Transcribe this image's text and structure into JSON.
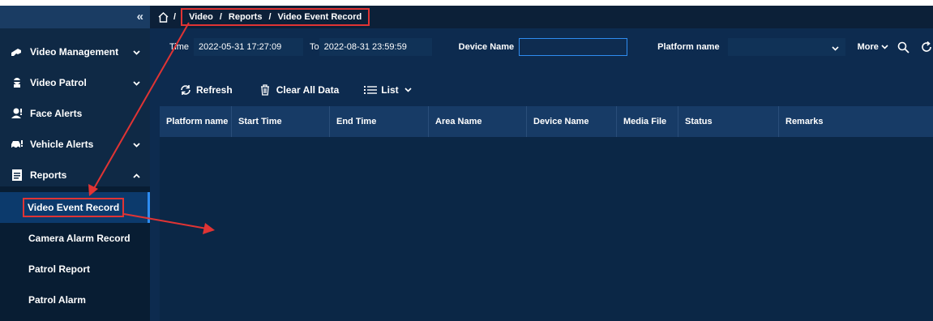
{
  "sidebar": {
    "items": [
      {
        "label": "Video Management",
        "icon": "video-management-icon"
      },
      {
        "label": "Video Patrol",
        "icon": "patrol-icon"
      },
      {
        "label": "Face Alerts",
        "icon": "face-icon"
      },
      {
        "label": "Vehicle Alerts",
        "icon": "vehicle-icon"
      },
      {
        "label": "Reports",
        "icon": "report-icon"
      }
    ],
    "subitems": [
      {
        "label": "Video Event Record"
      },
      {
        "label": "Camera Alarm Record"
      },
      {
        "label": "Patrol Report"
      },
      {
        "label": "Patrol Alarm"
      }
    ]
  },
  "breadcrumb": [
    "Video",
    "Reports",
    "Video Event Record"
  ],
  "filters": {
    "time_label": "Time",
    "time_start": "2022-05-31 17:27:09",
    "to_label": "To",
    "time_end": "2022-08-31 23:59:59",
    "device_label": "Device Name",
    "device_value": "",
    "platform_label": "Platform name",
    "platform_value": "",
    "more_label": "More"
  },
  "toolbar": {
    "refresh": "Refresh",
    "clear": "Clear All Data",
    "list": "List"
  },
  "table": {
    "columns": [
      "Platform name",
      "Start Time",
      "End Time",
      "Area Name",
      "Device Name",
      "Media File",
      "Status",
      "Remarks"
    ],
    "rows": []
  },
  "colors": {
    "accent": "#2e8cf0",
    "highlight": "#e03434",
    "background": "#0d2b4f"
  }
}
